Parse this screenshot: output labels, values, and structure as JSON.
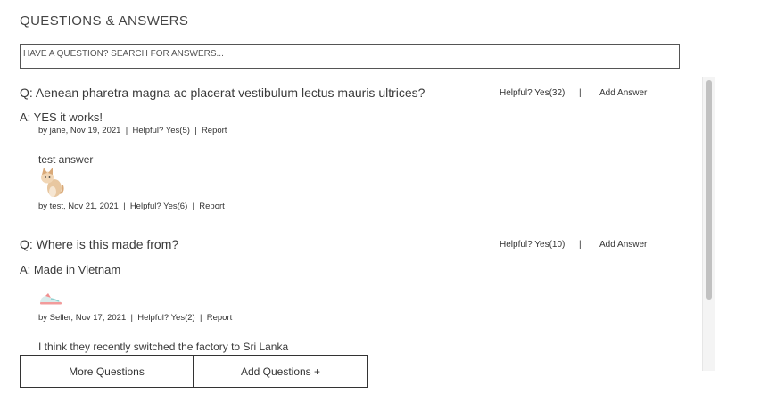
{
  "header": {
    "title": "QUESTIONS & ANSWERS"
  },
  "search": {
    "placeholder": "HAVE A QUESTION? SEARCH FOR ANSWERS..."
  },
  "questions": [
    {
      "text": "Q: Aenean pharetra magna ac placerat vestibulum lectus mauris ultrices?",
      "helpful": "Helpful? Yes(32)",
      "separator": "|",
      "add_answer": "Add Answer",
      "answers": [
        {
          "text": "A: YES it works!",
          "meta": {
            "by": "by jane, Nov 19, 2021",
            "helpful": "Helpful? Yes(5)",
            "report": "Report"
          }
        },
        {
          "body": "test answer",
          "meta": {
            "by": "by test, Nov 21, 2021",
            "helpful": "Helpful? Yes(6)",
            "report": "Report"
          }
        }
      ]
    },
    {
      "text": "Q: Where is this made from?",
      "helpful": "Helpful? Yes(10)",
      "separator": "|",
      "add_answer": "Add Answer",
      "answers": [
        {
          "text": "A: Made in Vietnam",
          "meta": {
            "by": "by Seller, Nov 17, 2021",
            "helpful": "Helpful? Yes(2)",
            "report": "Report"
          }
        },
        {
          "body": "I think they recently switched the factory to Sri Lanka"
        }
      ]
    }
  ],
  "meta_separator": "|",
  "footer": {
    "more_label": "More Questions",
    "add_label": "Add Questions +"
  }
}
